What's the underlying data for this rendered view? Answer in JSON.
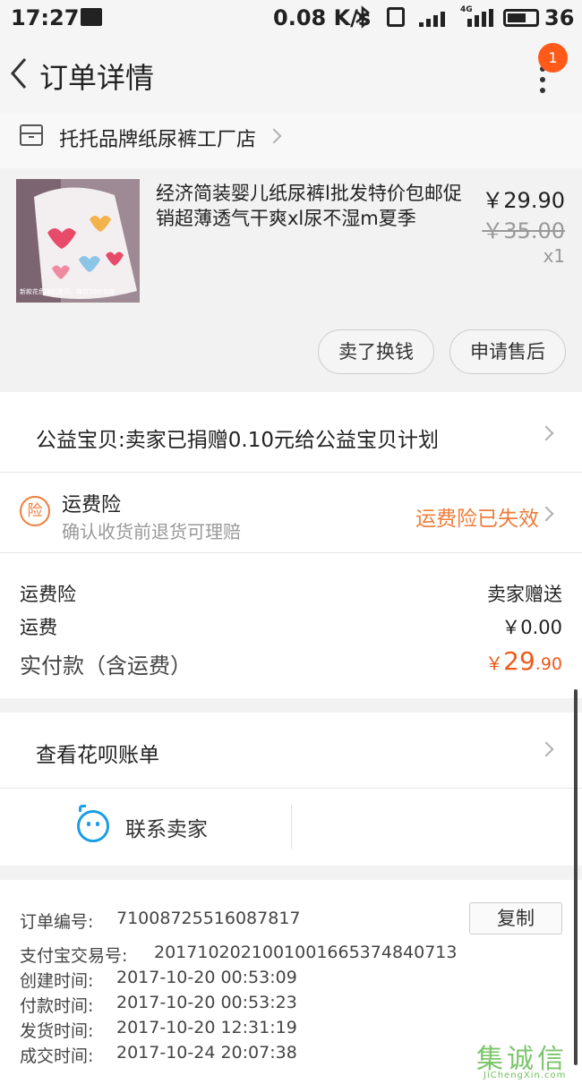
{
  "status_bar": {
    "time": "17:27",
    "speed": "0.08 K/s",
    "network": "4G",
    "battery": "36"
  },
  "header": {
    "title": "订单详情",
    "badge_count": "1"
  },
  "shop": {
    "name": "托托品牌纸尿裤工厂店"
  },
  "product": {
    "name": "经济简装婴儿纸尿裤l批发特价包邮促销超薄透气干爽xl尿不湿m夏季",
    "price": "￥29.90",
    "original_price": "￥35.00",
    "quantity": "x1",
    "image_caption": "新款花色随机发货，每包50片包邮",
    "buttons": {
      "resell": "卖了换钱",
      "after_sales": "申请售后"
    }
  },
  "donation": {
    "text": "公益宝贝:卖家已捐赠0.10元给公益宝贝计划"
  },
  "insurance": {
    "icon_char": "险",
    "title": "运费险",
    "subtitle": "确认收货前退货可理赔",
    "status": "运费险已失效"
  },
  "fees": {
    "rows": [
      {
        "label": "运费险",
        "value": "卖家赠送"
      },
      {
        "label": "运费",
        "value": "￥0.00"
      }
    ],
    "total_label": "实付款（含运费）",
    "total_currency": "￥",
    "total_integer": "29",
    "total_decimal": ".90"
  },
  "huabei": {
    "text": "查看花呗账单"
  },
  "contact": {
    "text": "联系卖家"
  },
  "order_info": {
    "copy_label": "复制",
    "rows": [
      {
        "label": "订单编号:",
        "value": "71008725516087817"
      },
      {
        "label": "支付宝交易号:",
        "value": "2017102021001001665374840713"
      },
      {
        "label": "创建时间:",
        "value": "2017-10-20 00:53:09"
      },
      {
        "label": "付款时间:",
        "value": "2017-10-20 00:53:23"
      },
      {
        "label": "发货时间:",
        "value": "2017-10-20 12:31:19"
      },
      {
        "label": "成交时间:",
        "value": "2017-10-24 20:07:38"
      }
    ]
  },
  "watermark": {
    "main": "集诚信",
    "sub": "JiChengXin.com"
  },
  "colors": {
    "accent_orange": "#ef7c3a",
    "price_orange": "#f05a1a",
    "badge": "#ff5a1a",
    "contact_blue": "#1b9de6"
  }
}
